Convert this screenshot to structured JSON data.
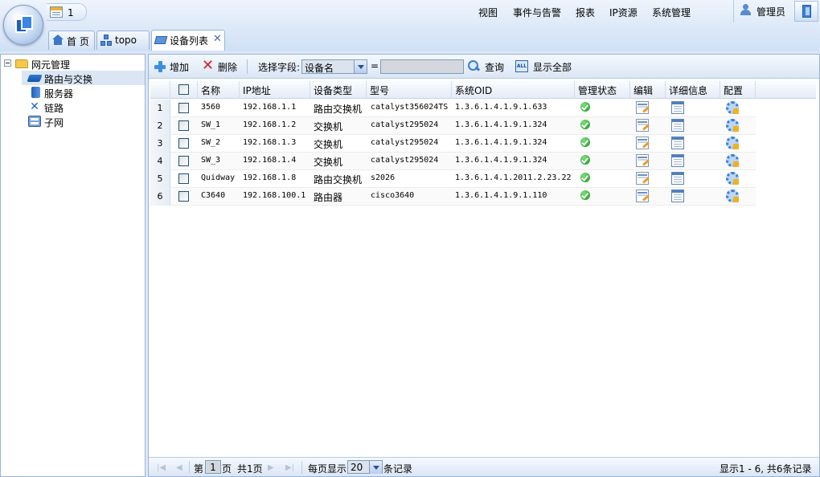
{
  "header": {
    "message_count": "1",
    "menu": [
      "视图",
      "事件与告警",
      "报表",
      "IP资源",
      "系统管理"
    ],
    "user_label": "管理员"
  },
  "tabs": [
    {
      "label": "首 页",
      "icon": "home-icon"
    },
    {
      "label": "topo",
      "icon": "topology-icon"
    },
    {
      "label": "设备列表",
      "icon": "device-list-icon",
      "active": true,
      "close": "✕"
    }
  ],
  "tree": {
    "root": {
      "label": "网元管理",
      "icon": "folder-icon"
    },
    "children": [
      {
        "label": "路由与交换",
        "icon": "router-icon",
        "selected": true
      },
      {
        "label": "服务器",
        "icon": "server-icon"
      },
      {
        "label": "链路",
        "icon": "link-icon"
      },
      {
        "label": "子网",
        "icon": "subnet-icon"
      }
    ]
  },
  "toolbar": {
    "add_label": "增加",
    "delete_label": "删除",
    "field_label": "选择字段:",
    "field_value": "设备名",
    "equals": "=",
    "search_value": "",
    "query_label": "查询",
    "show_all_label": "显示全部",
    "all_icon_text": "ALL"
  },
  "grid": {
    "columns": [
      "名称",
      "IP地址",
      "设备类型",
      "型号",
      "系统OID",
      "管理状态",
      "编辑",
      "详细信息",
      "配置"
    ],
    "rows": [
      {
        "num": "1",
        "name": "3560",
        "ip": "192.168.1.1",
        "type": "路由交换机",
        "model": "catalyst356024TS",
        "oid": "1.3.6.1.4.1.9.1.633",
        "status": "ok"
      },
      {
        "num": "2",
        "name": "SW_1",
        "ip": "192.168.1.2",
        "type": "交换机",
        "model": "catalyst295024",
        "oid": "1.3.6.1.4.1.9.1.324",
        "status": "ok"
      },
      {
        "num": "3",
        "name": "SW_2",
        "ip": "192.168.1.3",
        "type": "交换机",
        "model": "catalyst295024",
        "oid": "1.3.6.1.4.1.9.1.324",
        "status": "ok"
      },
      {
        "num": "4",
        "name": "SW_3",
        "ip": "192.168.1.4",
        "type": "交换机",
        "model": "catalyst295024",
        "oid": "1.3.6.1.4.1.9.1.324",
        "status": "ok"
      },
      {
        "num": "5",
        "name": "Quidway",
        "ip": "192.168.1.8",
        "type": "路由交换机",
        "model": "s2026",
        "oid": "1.3.6.1.4.1.2011.2.23.22",
        "status": "ok"
      },
      {
        "num": "6",
        "name": "C3640",
        "ip": "192.168.100.1",
        "type": "路由器",
        "model": "cisco3640",
        "oid": "1.3.6.1.4.1.9.1.110",
        "status": "ok"
      }
    ]
  },
  "pager": {
    "page_prefix": "第",
    "page_value": "1",
    "page_suffix": "页",
    "total_pages": "共1页",
    "per_page_label": "每页显示",
    "per_page_value": "20",
    "records_label": "条记录",
    "summary": "显示1 - 6, 共6条记录"
  },
  "colors": {
    "header_bg": "#cfe0f5",
    "border": "#99b4d8",
    "status_ok": "#12941a",
    "delete": "#d21f1f"
  }
}
